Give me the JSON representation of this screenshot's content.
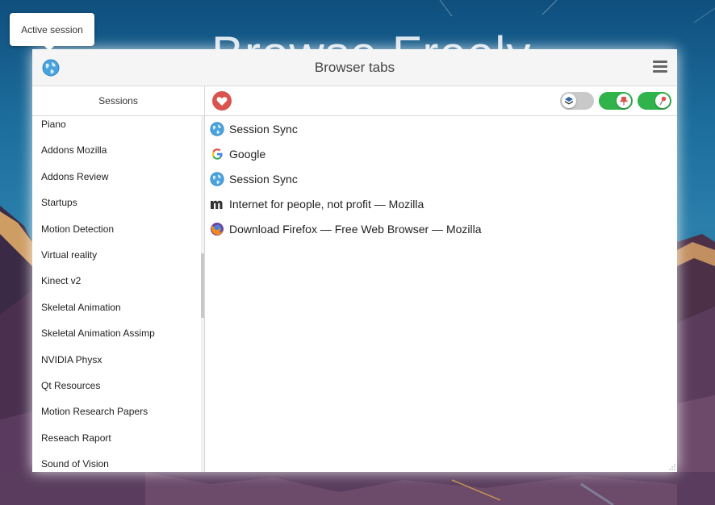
{
  "background": {
    "headline": "Browse Freely",
    "colors": {
      "sky_top": "#0f4f7e",
      "mountain": "#4a2f47",
      "mountain_highlight": "#f0c070"
    }
  },
  "tooltip": {
    "text": "Active session"
  },
  "window": {
    "title": "Browser tabs",
    "title_icon": "globe-icon",
    "menu_icon": "hamburger-menu-icon"
  },
  "sidebar": {
    "header": "Sessions",
    "items": [
      "Piano",
      "Addons Mozilla",
      "Addons Review",
      "Startups",
      "Motion Detection",
      "Virtual reality",
      "Kinect v2",
      "Skeletal Animation",
      "Skeletal Animation Assimp",
      "NVIDIA Physx",
      "Qt Resources",
      "Motion Research Papers",
      "Reseach Raport",
      "Sound of Vision"
    ]
  },
  "toolbar": {
    "favorite_icon": "heart-icon",
    "toggles": [
      {
        "name": "layers-toggle",
        "icon": "layers-icon",
        "state": "off"
      },
      {
        "name": "pin-toggle",
        "icon": "pin-icon",
        "state": "on"
      },
      {
        "name": "location-toggle",
        "icon": "location-pin-icon",
        "state": "on"
      }
    ],
    "colors": {
      "heart": "#d9534f",
      "toggle_on": "#2fb34a",
      "toggle_off": "#c9c9c9"
    }
  },
  "tabs": [
    {
      "title": "Session Sync",
      "icon": "globe-icon"
    },
    {
      "title": "Google",
      "icon": "google-icon"
    },
    {
      "title": "Session Sync",
      "icon": "globe-icon"
    },
    {
      "title": "Internet for people, not profit — Mozilla",
      "icon": "mozilla-icon"
    },
    {
      "title": "Download Firefox — Free Web Browser — Mozilla",
      "icon": "firefox-icon"
    }
  ]
}
